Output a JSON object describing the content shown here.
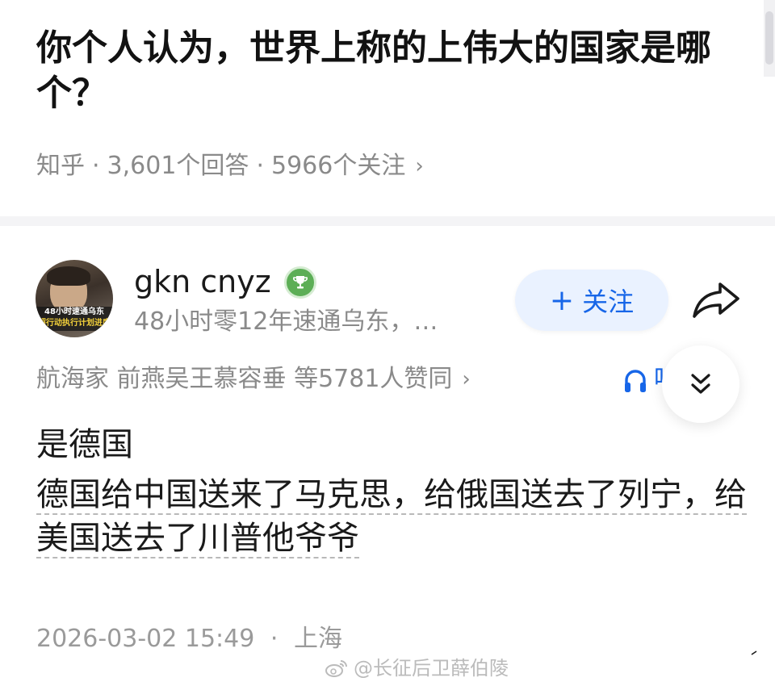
{
  "question": {
    "title": "你个人认为，世界上称的上伟大的国家是哪个？",
    "source": "知乎",
    "answer_count": "3,601个回答",
    "follower_count": "5966个关注",
    "chevron": "›"
  },
  "answer": {
    "author": {
      "name": "gkn cnyz",
      "bio": "48小时零12年速通乌东，…",
      "avatar_caption_1": "48小时速通乌东",
      "avatar_caption_2": "超行动执行计划进度",
      "badge_icon": "trophy-icon"
    },
    "follow_button": {
      "plus": "+",
      "label": "关注"
    },
    "likers": {
      "text": "航海家 前燕吴王慕容垂 等5781人赞同",
      "chevron": "›"
    },
    "listen_label": "听",
    "lead": "是德国",
    "body": "德国给中国送来了马克思，给俄国送去了列宁，给美国送去了川普他爷爷",
    "date": "2026-03-02 15:49",
    "location": "上海"
  },
  "watermark": "@长征后卫薛伯陵",
  "colors": {
    "accent_blue": "#1766e8",
    "follow_bg": "#eaf2ff",
    "muted_text": "#8a8a8a",
    "badge_green": "#5cae56"
  }
}
